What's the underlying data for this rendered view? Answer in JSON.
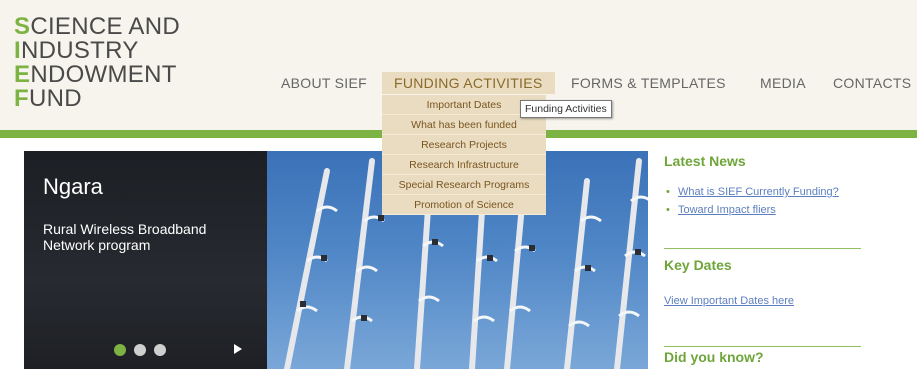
{
  "logo": {
    "lines": [
      {
        "initial": "S",
        "rest": "CIENCE AND"
      },
      {
        "initial": "I",
        "rest": "NDUSTRY"
      },
      {
        "initial": "E",
        "rest": "NDOWMENT"
      },
      {
        "initial": "F",
        "rest": "UND"
      }
    ]
  },
  "nav": {
    "items": [
      {
        "label": "ABOUT SIEF"
      },
      {
        "label": "FUNDING ACTIVITIES"
      },
      {
        "label": "FORMS & TEMPLATES"
      },
      {
        "label": "MEDIA"
      },
      {
        "label": "CONTACTS"
      }
    ],
    "dropdown": [
      "Important Dates",
      "What has been funded",
      "Research Projects",
      "Research Infrastructure",
      "Special Research Programs",
      "Promotion of Science"
    ],
    "tooltip": "Funding Activities"
  },
  "hero": {
    "title": "Ngara",
    "subtitle": "Rural Wireless Broadband Network program"
  },
  "sidebar": {
    "latest_news": {
      "heading": "Latest News",
      "items": [
        "What is SIEF Currently Funding?",
        "Toward Impact fliers"
      ]
    },
    "key_dates": {
      "heading": "Key Dates",
      "link": "View Important Dates here"
    },
    "did_you_know": {
      "heading": "Did you know?"
    }
  },
  "colors": {
    "accent_green": "#7db343",
    "nav_active_bg": "#e9dcc0",
    "link_blue": "#5d7fbf"
  }
}
